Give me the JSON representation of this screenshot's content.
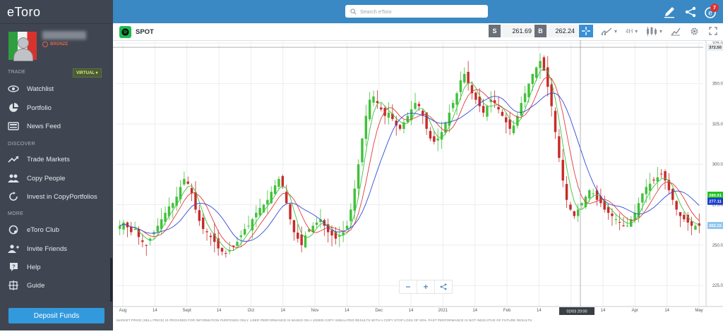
{
  "sidebar": {
    "logo": "eToro",
    "user_tier": "BRONZE",
    "sections": {
      "trade": "TRADE",
      "discover": "DISCOVER",
      "more": "MORE"
    },
    "mode_badge": "VIRTUAL ▾",
    "items": [
      {
        "label": "Watchlist",
        "icon": "eye-icon"
      },
      {
        "label": "Portfolio",
        "icon": "pie-chart-icon"
      },
      {
        "label": "News Feed",
        "icon": "newspaper-icon"
      },
      {
        "label": "Trade Markets",
        "icon": "trend-up-icon"
      },
      {
        "label": "Copy People",
        "icon": "people-icon"
      },
      {
        "label": "Invest in CopyPortfolios",
        "icon": "portfolio-refresh-icon"
      },
      {
        "label": "eToro Club",
        "icon": "club-icon"
      },
      {
        "label": "Invite Friends",
        "icon": "add-user-icon"
      },
      {
        "label": "Help",
        "icon": "help-icon"
      },
      {
        "label": "Guide",
        "icon": "guide-icon"
      }
    ],
    "deposit_label": "Deposit Funds"
  },
  "topbar": {
    "search_placeholder": "Search eToro",
    "notification_count": "7"
  },
  "instrument": {
    "symbol": "SPOT",
    "sell_label": "S",
    "sell_price": "261.69",
    "buy_label": "B",
    "buy_price": "262.24",
    "timeframe": "4H"
  },
  "chart_data": {
    "type": "candlestick",
    "y_ticks": [
      "375.00",
      "350.00",
      "325.00",
      "300.00",
      "275.00",
      "250.00",
      "225.00"
    ],
    "ylim": [
      212,
      376
    ],
    "x_ticks": [
      "Aug",
      "14",
      "Sept",
      "14",
      "Oct",
      "14",
      "Nov",
      "14",
      "Dec",
      "14",
      "2021",
      "14",
      "Feb",
      "14",
      "Mar",
      "14",
      "Apr",
      "14",
      "May"
    ],
    "price_labels": [
      {
        "value": "372.50",
        "color": "#e9ecef",
        "text_color": "#333"
      },
      {
        "value": "280.91",
        "color": "#22c322",
        "text_color": "#fff"
      },
      {
        "value": "277.11",
        "color": "#1a3fc9",
        "text_color": "#fff"
      },
      {
        "value": "262.15",
        "color": "#8fc6ee",
        "text_color": "#fff"
      }
    ],
    "crosshair_label": "02/03 20:00",
    "closes": [
      262,
      264,
      261,
      258,
      260,
      255,
      252,
      250,
      254,
      258,
      262,
      266,
      270,
      274,
      276,
      280,
      286,
      291,
      288,
      282,
      272,
      265,
      260,
      258,
      255,
      252,
      248,
      246,
      245,
      247,
      249,
      252,
      256,
      260,
      262,
      266,
      270,
      273,
      275,
      278,
      283,
      287,
      291,
      286,
      276,
      266,
      258,
      254,
      250,
      256,
      260,
      262,
      264,
      266,
      262,
      258,
      256,
      254,
      256,
      258,
      262,
      272,
      285,
      300,
      316,
      330,
      340,
      342,
      338,
      334,
      330,
      332,
      328,
      324,
      322,
      326,
      330,
      334,
      338,
      336,
      330,
      322,
      316,
      314,
      316,
      320,
      326,
      332,
      338,
      344,
      352,
      356,
      350,
      344,
      340,
      336,
      332,
      336,
      340,
      338,
      334,
      330,
      326,
      322,
      324,
      330,
      338,
      344,
      350,
      356,
      360,
      364,
      358,
      348,
      336,
      320,
      304,
      290,
      278,
      272,
      268,
      272,
      276,
      280,
      284,
      282,
      278,
      276,
      272,
      270,
      268,
      266,
      264,
      262,
      262,
      266,
      270,
      276,
      282,
      286,
      288,
      290,
      292,
      294,
      290,
      284,
      278,
      272,
      268,
      266,
      264,
      262,
      262,
      262
    ]
  },
  "controls": {
    "zoom_out": "−",
    "zoom_in": "+"
  },
  "disclaimer": "MARKET PRICE (SELL PRICE) IS PROVIDED FOR INFORMATION PURPOSES ONLY. USER PERFORMANCE IS BASED ON A 100000 COPY SIMULATED RESULTS WITH A COPY STOP LOSS OF 50%. PAST PERFORMANCE IS NOT INDICATIVE OF FUTURE RESULTS."
}
